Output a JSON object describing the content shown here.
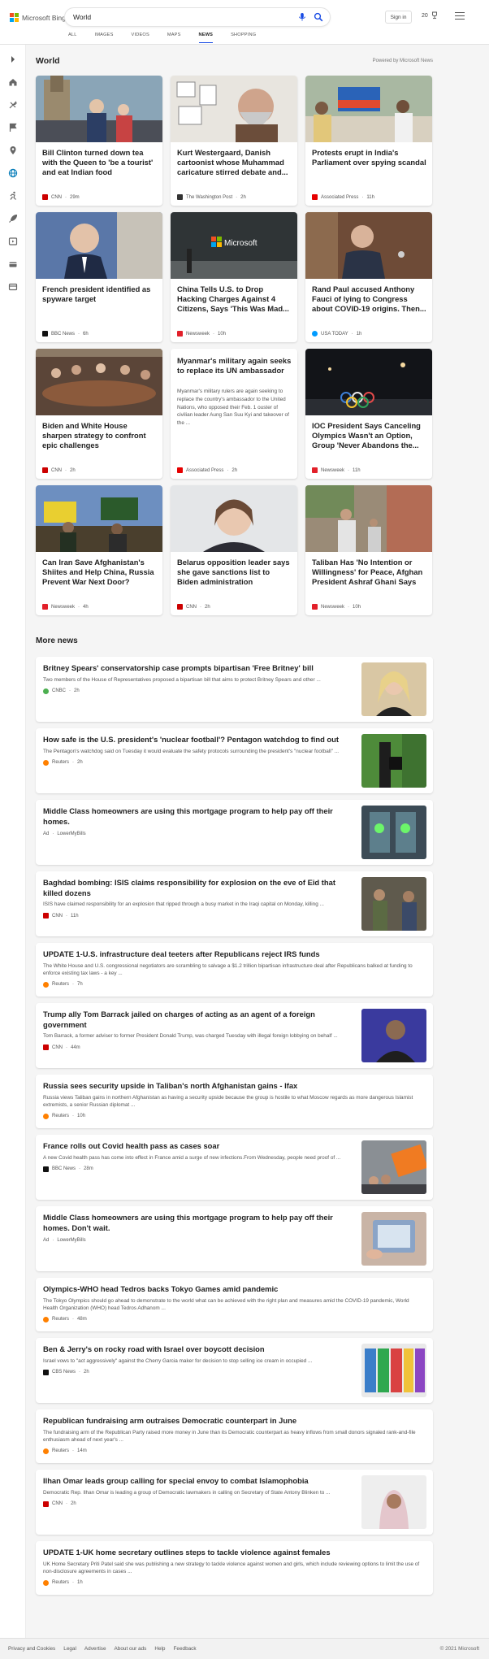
{
  "header": {
    "logo_text": "Microsoft Bing",
    "search_value": "World",
    "signin_label": "Sign in",
    "rewards_count": "20",
    "tabs": [
      {
        "label": "ALL",
        "active": false
      },
      {
        "label": "IMAGES",
        "active": false
      },
      {
        "label": "VIDEOS",
        "active": false
      },
      {
        "label": "MAPS",
        "active": false
      },
      {
        "label": "NEWS",
        "active": true
      },
      {
        "label": "SHOPPING",
        "active": false
      }
    ]
  },
  "sidebar": {
    "icons": [
      "chevron-right-icon",
      "home-icon",
      "tools-icon",
      "flag-icon",
      "location-icon",
      "globe-icon",
      "running-icon",
      "rocket-icon",
      "video-icon",
      "coin-icon",
      "card-icon"
    ]
  },
  "section": {
    "title": "World",
    "powered_by": "Powered by Microsoft News"
  },
  "cards": [
    {
      "title": "Bill Clinton turned down tea with the Queen to 'be a tourist' and eat Indian food",
      "source": "CNN",
      "time": "29m",
      "src_color": "#cc0000"
    },
    {
      "title": "Kurt Westergaard, Danish cartoonist whose Muhammad caricature stirred debate and...",
      "source": "The Washington Post",
      "time": "2h",
      "src_color": "#333333"
    },
    {
      "title": "Protests erupt in India's Parliament over spying scandal",
      "source": "Associated Press",
      "time": "11h",
      "src_color": "#e60000"
    },
    {
      "title": "French president identified as spyware target",
      "source": "BBC News",
      "time": "6h",
      "src_color": "#111111"
    },
    {
      "title": "China Tells U.S. to Drop Hacking Charges Against 4 Citizens, Says 'This Was Mad...",
      "source": "Newsweek",
      "time": "10h",
      "src_color": "#e2202a"
    },
    {
      "title": "Rand Paul accused Anthony Fauci of lying to Congress about COVID-19 origins. Then...",
      "source": "USA TODAY",
      "time": "1h",
      "src_color": "#009bff"
    },
    {
      "title": "Biden and White House sharpen strategy to confront epic challenges",
      "source": "CNN",
      "time": "2h",
      "src_color": "#cc0000"
    },
    {
      "title": "Myanmar's military again seeks to replace its UN ambassador",
      "snippet": "Myanmar's military rulers are again seeking to replace the country's ambassador to the United Nations, who opposed their Feb. 1 ouster of civilian leader Aung San Suu Kyi and takeover of the ...",
      "source": "Associated Press",
      "time": "2h",
      "src_color": "#e60000"
    },
    {
      "title": "IOC President Says Canceling Olympics Wasn't an Option, Group 'Never Abandons the...",
      "source": "Newsweek",
      "time": "11h",
      "src_color": "#e2202a"
    },
    {
      "title": "Can Iran Save Afghanistan's Shiites and Help China, Russia Prevent War Next Door?",
      "source": "Newsweek",
      "time": "4h",
      "src_color": "#e2202a"
    },
    {
      "title": "Belarus opposition leader says she gave sanctions list to Biden administration",
      "source": "CNN",
      "time": "2h",
      "src_color": "#cc0000"
    },
    {
      "title": "Taliban Has 'No Intention or Willingness' for Peace, Afghan President Ashraf Ghani Says",
      "source": "Newsweek",
      "time": "10h",
      "src_color": "#e2202a"
    }
  ],
  "more_news_title": "More news",
  "more_news": [
    {
      "title": "Britney Spears' conservatorship case prompts bipartisan 'Free Britney' bill",
      "desc": "Two members of the House of Representatives proposed a bipartisan bill that aims to protect Britney Spears and other ...",
      "source": "CNBC",
      "time": "2h",
      "src_color": "#4caf50"
    },
    {
      "title": "How safe is the U.S. president's 'nuclear football'? Pentagon watchdog to find out",
      "desc": "The Pentagon's watchdog said on Tuesday it would evaluate the safety protocols surrounding the president's \"nuclear football\" ...",
      "source": "Reuters",
      "time": "2h",
      "src_color": "#ff8000"
    },
    {
      "title": "Middle Class homeowners are using this mortgage program to help pay off their homes.",
      "desc": "",
      "source": "LowerMyBills",
      "time": "",
      "ad": "Ad",
      "src_color": ""
    },
    {
      "title": "Baghdad bombing: ISIS claims responsibility for explosion on the eve of Eid that killed dozens",
      "desc": "ISIS have claimed responsibility for an explosion that ripped through a busy market in the Iraqi capital on Monday, killing ...",
      "source": "CNN",
      "time": "11h",
      "src_color": "#cc0000"
    },
    {
      "title": "UPDATE 1-U.S. infrastructure deal teeters after Republicans reject IRS funds",
      "desc": "The White House and U.S. congressional negotiators are scrambling to salvage a $1.2 trillion bipartisan infrastructure deal after Republicans balked at funding to enforce existing tax laws - a key ...",
      "source": "Reuters",
      "time": "7h",
      "src_color": "#ff8000"
    },
    {
      "title": "Trump ally Tom Barrack jailed on charges of acting as an agent of a foreign government",
      "desc": "Tom Barrack, a former adviser to former President Donald Trump, was charged Tuesday with illegal foreign lobbying on behalf ...",
      "source": "CNN",
      "time": "44m",
      "src_color": "#cc0000"
    },
    {
      "title": "Russia sees security upside in Taliban's north Afghanistan gains - Ifax",
      "desc": "Russia views Taliban gains in northern Afghanistan as having a security upside because the group is hostile to what Moscow regards as more dangerous Islamist extremists, a senior Russian diplomat ...",
      "source": "Reuters",
      "time": "10h",
      "src_color": "#ff8000"
    },
    {
      "title": "France rolls out Covid health pass as cases soar",
      "desc": "A new Covid health pass has come into effect in France amid a surge of new infections.From Wednesday, people need proof of ...",
      "source": "BBC News",
      "time": "28m",
      "src_color": "#111111"
    },
    {
      "title": "Middle Class homeowners are using this mortgage program to help pay off their homes. Don't wait.",
      "desc": "",
      "source": "LowerMyBills",
      "time": "",
      "ad": "Ad",
      "src_color": ""
    },
    {
      "title": "Olympics-WHO head Tedros backs Tokyo Games amid pandemic",
      "desc": "The Tokyo Olympics should go ahead to demonstrate to the world what can be achieved with the right plan and measures amid the COVID-19 pandemic, World Health Organization (WHO) head Tedros Adhanom ...",
      "source": "Reuters",
      "time": "48m",
      "src_color": "#ff8000"
    },
    {
      "title": "Ben & Jerry's on rocky road with Israel over boycott decision",
      "desc": "Israel vows to \"act aggressively\" against the Cherry Garcia maker for decision to stop selling ice cream in occupied ...",
      "source": "CBS News",
      "time": "2h",
      "src_color": "#111111"
    },
    {
      "title": "Republican fundraising arm outraises Democratic counterpart in June",
      "desc": "The fundraising arm of the Republican Party raised more money in June than its Democratic counterpart as heavy inflows from small donors signaled rank-and-file enthusiasm ahead of next year's ...",
      "source": "Reuters",
      "time": "14m",
      "src_color": "#ff8000"
    },
    {
      "title": "Ilhan Omar leads group calling for special envoy to combat Islamophobia",
      "desc": "Democratic Rep. Ilhan Omar is leading a group of Democratic lawmakers in calling on Secretary of State Antony Blinken to ...",
      "source": "CNN",
      "time": "2h",
      "src_color": "#cc0000"
    },
    {
      "title": "UPDATE 1-UK home secretary outlines steps to tackle violence against females",
      "desc": "UK Home Secretary Priti Patel said she was publishing a new strategy to tackle violence against women and girls, which include reviewing options to limit the use of non-disclosure agreements in cases ...",
      "source": "Reuters",
      "time": "1h",
      "src_color": "#ff8000"
    }
  ],
  "footer": {
    "links": [
      "Privacy and Cookies",
      "Legal",
      "Advertise",
      "About our ads",
      "Help",
      "Feedback"
    ],
    "copyright": "© 2021 Microsoft"
  }
}
